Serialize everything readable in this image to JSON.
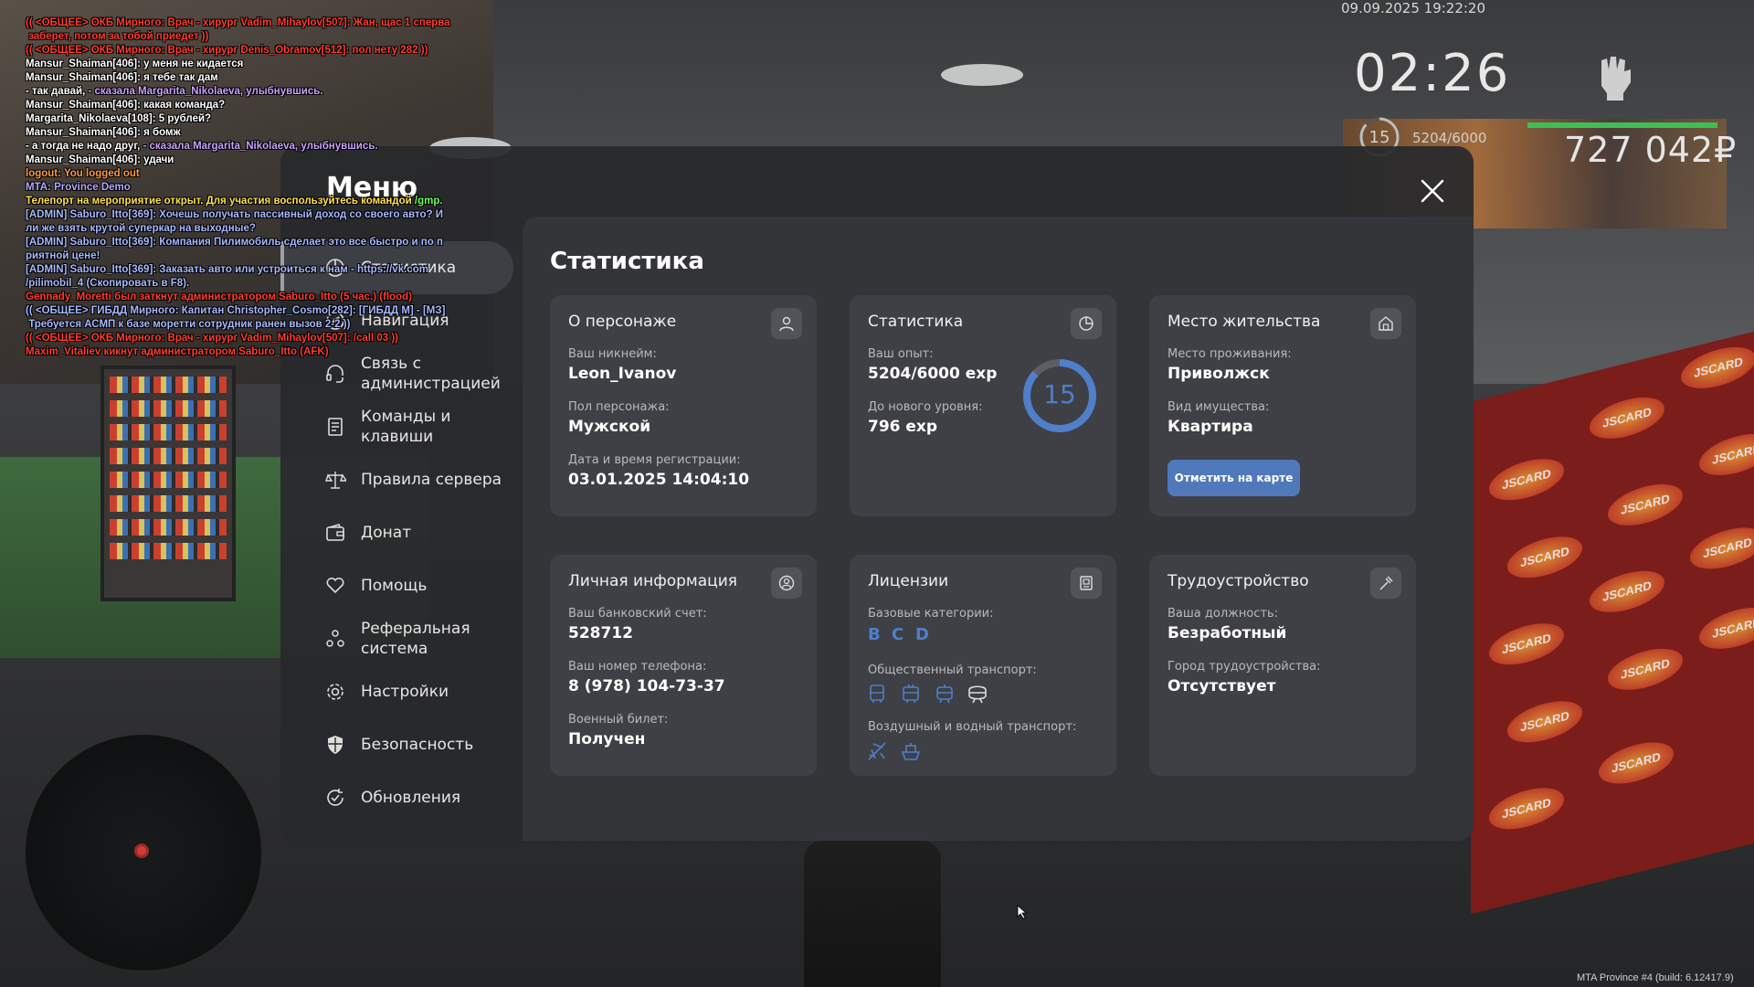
{
  "chat": [
    {
      "parts": [
        {
          "text": "(( <ОБЩЕЕ> ОКБ Мирного: Врач - хирург Vadim_Mihaylov[507]: Жан, щас 1 сперва",
          "color": "red"
        }
      ]
    },
    {
      "parts": [
        {
          "text": " заберет, потом за тобой приедет ))",
          "color": "red"
        }
      ]
    },
    {
      "parts": [
        {
          "text": "(( <ОБЩЕЕ> ОКБ Мирного: Врач - хирург Denis_Obramov[512]: пол нету 282 ))",
          "color": "red"
        }
      ]
    },
    {
      "parts": [
        {
          "text": "Mansur_Shaiman[406]: у меня не кидается",
          "color": "white"
        }
      ]
    },
    {
      "parts": [
        {
          "text": "Mansur_Shaiman[406]: я тебе так дам",
          "color": "white"
        }
      ]
    },
    {
      "parts": [
        {
          "text": "- так давай, ",
          "color": "white"
        },
        {
          "text": "- сказала Margarita_Nikolaeva, улыбнувшись.",
          "color": "pink"
        }
      ]
    },
    {
      "parts": [
        {
          "text": "Mansur_Shaiman[406]: какая команда?",
          "color": "white"
        }
      ]
    },
    {
      "parts": [
        {
          "text": "Margarita_Nikolaeva[108]: 5 рублей?",
          "color": "white"
        }
      ]
    },
    {
      "parts": [
        {
          "text": "Mansur_Shaiman[406]: я бомж",
          "color": "white"
        }
      ]
    },
    {
      "parts": [
        {
          "text": "- а тогда не надо друг, ",
          "color": "white"
        },
        {
          "text": "- сказала Margarita_Nikolaeva, улыбнувшись.",
          "color": "pink"
        }
      ]
    },
    {
      "parts": [
        {
          "text": "Mansur_Shaiman[406]: удачи",
          "color": "white"
        }
      ]
    },
    {
      "parts": [
        {
          "text": "logout: You logged out",
          "color": "orange"
        }
      ]
    },
    {
      "parts": [
        {
          "text": "MTA: Province Demo",
          "color": "violet"
        }
      ]
    },
    {
      "parts": [
        {
          "text": "Телепорт на мероприятие открыт. Для участия воспользуйтесь командой ",
          "color": "yellow"
        },
        {
          "text": "/gmp.",
          "color": "green"
        }
      ]
    },
    {
      "parts": [
        {
          "text": "[ADMIN] Saburo_Itto[369]: Хочешь получать пассивный доход со своего авто? И",
          "color": "blue"
        }
      ]
    },
    {
      "parts": [
        {
          "text": "ли же взять крутой суперкар на выходные?",
          "color": "blue"
        }
      ]
    },
    {
      "parts": [
        {
          "text": "[ADMIN] Saburo_Itto[369]: Компания Пилимобиль сделает это все быстро и по п",
          "color": "blue"
        }
      ]
    },
    {
      "parts": [
        {
          "text": "риятной цене!",
          "color": "blue"
        }
      ]
    },
    {
      "parts": [
        {
          "text": "[ADMIN] Saburo_Itto[369]: Заказать авто или устроиться к нам - https://vk.com",
          "color": "blue"
        }
      ]
    },
    {
      "parts": [
        {
          "text": "/pilimobil_4 (Скопировать в F8).",
          "color": "blue"
        }
      ]
    },
    {
      "parts": [
        {
          "text": "Gennady_Moretti был заткнут администратором Saburo_Itto (5 час.) (flood)",
          "color": "red"
        }
      ]
    },
    {
      "parts": [
        {
          "text": "(( <ОБЩЕЕ> ГИБДД Мирного: Капитан Christopher_Cosmo[282]: [ГИБДД М] - [МЗ]",
          "color": "blue"
        }
      ]
    },
    {
      "parts": [
        {
          "text": " Требуется АСМП к базе моретти сотрудник ранен вызов 2-2 ))",
          "color": "blue"
        }
      ]
    },
    {
      "parts": [
        {
          "text": "(( <ОБЩЕЕ> ОКБ Мирного: Врач - хирург Vadim_Mihaylov[507]: /call 03 ))",
          "color": "red"
        }
      ]
    },
    {
      "parts": [
        {
          "text": "Maxim_Vitaliev кикнут администратором Saburo_Itto (AFK)",
          "color": "red"
        }
      ]
    }
  ],
  "hud": {
    "datetime": "09.09.2025 19:22:20",
    "time": "02:26",
    "level": "15",
    "exp": "5204/6000",
    "money": "727 042₽",
    "build": "MTA Province #4 (build: 6.12417.9)"
  },
  "menu": {
    "title": "Меню",
    "sidebar": [
      {
        "label": "Статистика",
        "icon": "stats-icon",
        "active": true
      },
      {
        "label": "Навигация",
        "icon": "navigation-icon",
        "active": false
      },
      {
        "label": "Связь с администрацией",
        "icon": "headset-icon",
        "active": false
      },
      {
        "label": "Команды и клавиши",
        "icon": "document-icon",
        "active": false
      },
      {
        "label": "Правила сервера",
        "icon": "scales-icon",
        "active": false
      },
      {
        "label": "Донат",
        "icon": "wallet-icon",
        "active": false
      },
      {
        "label": "Помощь",
        "icon": "heart-hand-icon",
        "active": false
      },
      {
        "label": "Реферальная система",
        "icon": "people-icon",
        "active": false
      },
      {
        "label": "Настройки",
        "icon": "gear-icon",
        "active": false
      },
      {
        "label": "Безопасность",
        "icon": "shield-icon",
        "active": false
      },
      {
        "label": "Обновления",
        "icon": "refresh-icon",
        "active": false
      }
    ],
    "content_title": "Статистика",
    "cards": {
      "character": {
        "title": "О персонаже",
        "nickname_label": "Ваш никнейм:",
        "nickname": "Leon_Ivanov",
        "gender_label": "Пол персонажа:",
        "gender": "Мужской",
        "reg_label": "Дата и время регистрации:",
        "reg": "03.01.2025 14:04:10"
      },
      "stats": {
        "title": "Статистика",
        "exp_label": "Ваш опыт:",
        "exp": "5204/6000 exp",
        "next_label": "До нового уровня:",
        "next": "796 exp",
        "level": "15",
        "progress": 0.867
      },
      "residence": {
        "title": "Место жительства",
        "place_label": "Место проживания:",
        "place": "Приволжск",
        "type_label": "Вид имущества:",
        "type": "Квартира",
        "button": "Отметить на карте"
      },
      "personal": {
        "title": "Личная информация",
        "bank_label": "Ваш банковский счет:",
        "bank": "528712",
        "phone_label": "Ваш номер телефона:",
        "phone": "8 (978) 104-73-37",
        "military_label": "Военный билет:",
        "military": "Получен"
      },
      "licenses": {
        "title": "Лицензии",
        "base_label": "Базовые категории:",
        "base": [
          "B",
          "C",
          "D"
        ],
        "public_label": "Общественный транспорт:",
        "public_icons": [
          "bus-icon",
          "trolleybus-icon",
          "tram-icon",
          "metro-icon"
        ],
        "airwater_label": "Воздушный и водный транспорт:",
        "airwater_icons": [
          "plane-icon",
          "boat-icon"
        ]
      },
      "employment": {
        "title": "Трудоустройство",
        "job_label": "Ваша должность:",
        "job": "Безработный",
        "city_label": "Город трудоустройства:",
        "city": "Отсутствует"
      }
    }
  },
  "colors": {
    "accent": "#4f7fc9",
    "button": "#4f79ba",
    "hp_bar": "#3fbf55",
    "panel": "#28292c",
    "card": "#3e4045"
  }
}
